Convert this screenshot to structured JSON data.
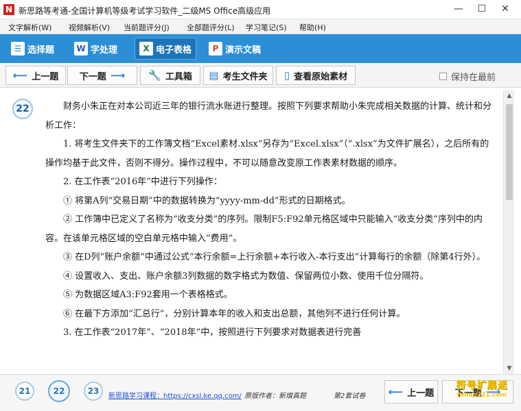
{
  "window": {
    "title": "新思路等考通-全国计算机等级考试学习软件_二级MS Office高级应用",
    "logo_letter": "N",
    "min_glyph": "—",
    "max_glyph": "☐",
    "close_glyph": "✕"
  },
  "menu": [
    "文字解析(W)",
    "视频解析(V)",
    "当前题评分(J)",
    "全部题评分(L)",
    "学习笔记(S)",
    "帮助(H)"
  ],
  "modes": [
    {
      "icon": "☰",
      "label": "选择题"
    },
    {
      "icon": "W",
      "label": "字处理"
    },
    {
      "icon": "X",
      "label": "电子表格"
    },
    {
      "icon": "P",
      "label": "演示文稿"
    }
  ],
  "toolbar": {
    "prev": "上一题",
    "next": "下一题",
    "tools": "工具箱",
    "candidate_folder": "考生文件夹",
    "original_material": "查看原始素材",
    "keep_on_top": "保持在最前"
  },
  "question": {
    "number": "22",
    "paragraphs": [
      "财务小朱正在对本公司近三年的银行流水账进行整理。按照下列要求帮助小朱完成相关数据的计算、统计和分析工作：",
      "1. 将考生文件夹下的工作簿文档“Excel素材.xlsx”另存为“Excel.xlsx”（“.xlsx”为文件扩展名），之后所有的操作均基于此文件，否则不得分。操作过程中，不可以随意改变原工作表素材数据的顺序。",
      "2. 在工作表“2016年”中进行下列操作：",
      "① 将第A列“交易日期”中的数据转换为“yyyy-mm-dd”形式的日期格式。",
      "② 工作簿中已定义了名称为“收支分类”的序列。限制F5:F92单元格区域中只能输入“收支分类”序列中的内容。在该单元格区域的空白单元格中输入“费用”。",
      "③ 在D列“账户余额”中通过公式“本行余额=上行余额+本行收入-本行支出”计算每行的余额（除第4行外）。",
      "④ 设置收入、支出、账户余额3列数据的数字格式为数值、保留两位小数、使用千位分隔符。",
      "⑤ 为数据区域A3:F92套用一个表格格式。",
      "⑥ 在最下方添加“汇总行”，分别计算本年的收入和支出总额，其他列不进行任何计算。",
      "3. 在工作表“2017年”、“2018年”中，按照进行下列要求对数据表进行完善"
    ]
  },
  "scrollbar": {
    "up": "▲",
    "down": "▼"
  },
  "bottom": {
    "numbers": [
      "21",
      "22",
      "23"
    ],
    "link": "新思路学习课程：https://cxsl.ke.qq.com/",
    "author": "原版作者：新增真题",
    "set": "第2套试卷",
    "prev": "上一题",
    "next": "下一题"
  },
  "watermark": {
    "main": "符号扩展迷",
    "sub": "fuhao321.com"
  }
}
